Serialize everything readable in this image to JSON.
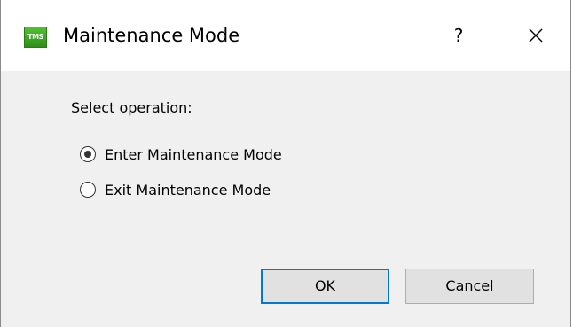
{
  "dialog": {
    "title": "Maintenance Mode",
    "icon_text": "TMS",
    "help_label": "?",
    "close_icon": "close-icon"
  },
  "form": {
    "prompt": "Select operation:",
    "options": [
      {
        "label": "Enter Maintenance Mode",
        "selected": true
      },
      {
        "label": "Exit Maintenance Mode",
        "selected": false
      }
    ]
  },
  "buttons": {
    "ok_label": "OK",
    "cancel_label": "Cancel"
  },
  "colors": {
    "accent": "#0078d7",
    "icon_green": "#3aa821",
    "dialog_bg": "#f0f0f0"
  }
}
